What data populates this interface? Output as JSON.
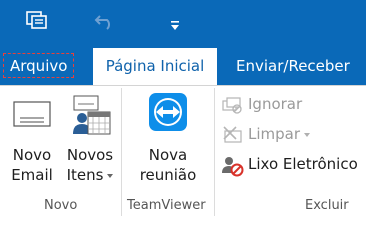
{
  "colors": {
    "accent": "#0a69b8",
    "active_tab_text": "#0f62ab",
    "file_tab_outline": "#e8403a",
    "disabled_text": "#9a9a9a"
  },
  "quick_access": [
    {
      "icon": "send-receive-folders-icon"
    },
    {
      "icon": "undo-icon"
    },
    {
      "icon": "customize-qat-dropdown-icon"
    }
  ],
  "tabs": [
    {
      "label": "Arquivo"
    },
    {
      "label": "Página Inicial"
    },
    {
      "label": "Enviar/Receber"
    }
  ],
  "groups": {
    "novo": {
      "label": "Novo",
      "new_email": {
        "line1": "Novo",
        "line2": "Email",
        "icon": "new-email-icon"
      },
      "new_items": {
        "line1": "Novos",
        "line2": "Itens",
        "icon": "new-items-icon"
      }
    },
    "teamviewer": {
      "label": "TeamViewer",
      "new_meeting": {
        "line1": "Nova",
        "line2": "reunião",
        "icon": "teamviewer-icon"
      }
    },
    "excluir": {
      "label": "Excluir",
      "ignore": {
        "label": "Ignorar",
        "icon": "ignore-icon"
      },
      "clean_up": {
        "label": "Limpar",
        "icon": "clean-up-icon"
      },
      "junk": {
        "label": "Lixo Eletrônico",
        "icon": "junk-email-icon"
      }
    }
  }
}
